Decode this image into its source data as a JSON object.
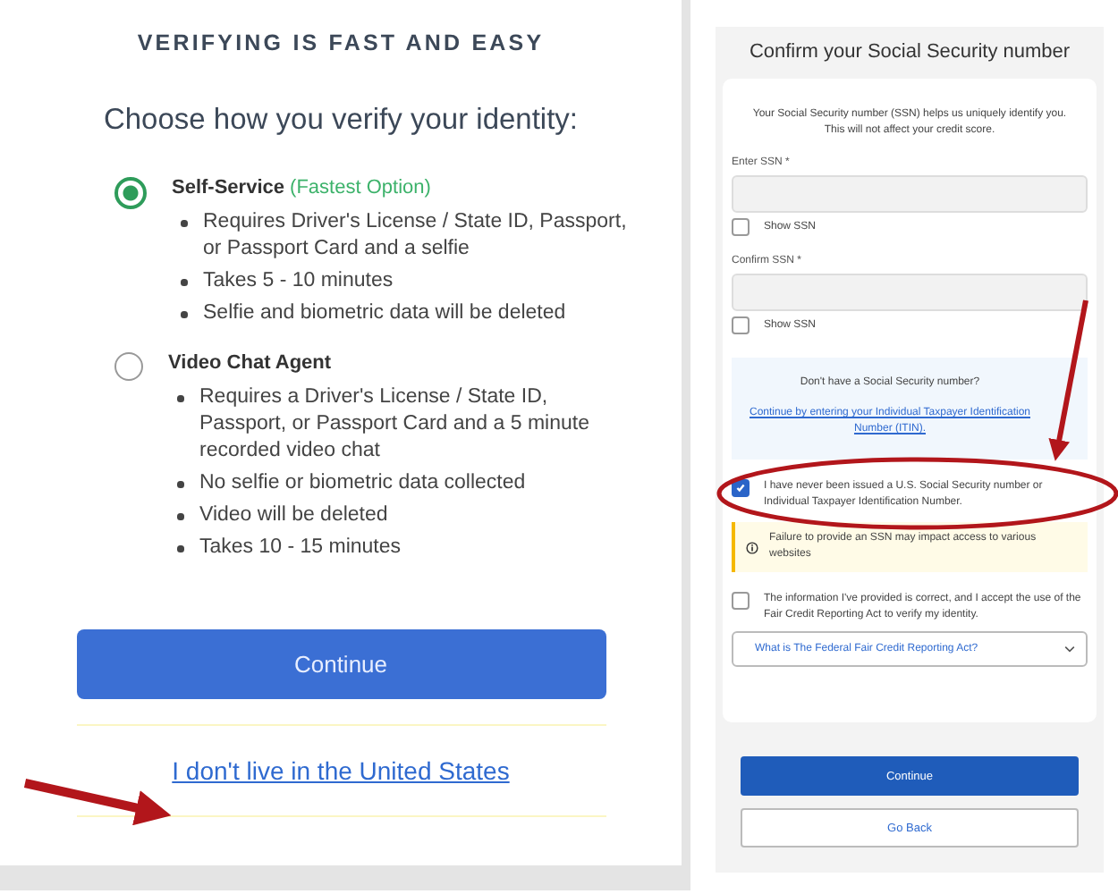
{
  "left": {
    "heading": "VERIFYING IS FAST AND EASY",
    "question": "Choose how you verify your identity:",
    "options": [
      {
        "title": "Self-Service",
        "note": "(Fastest Option)",
        "selected": true,
        "bullets": [
          "Requires Driver's License / State ID, Passport, or Passport Card and a selfie",
          "Takes 5 - 10 minutes",
          "Selfie and biometric data will be deleted"
        ]
      },
      {
        "title": "Video Chat Agent",
        "selected": false,
        "bullets": [
          "Requires a Driver's License / State ID, Passport, or Passport Card and a 5 minute recorded video chat",
          "No selfie or biometric data collected",
          "Video will be deleted",
          "Takes 10 - 15 minutes"
        ]
      }
    ],
    "continue_button": "Continue",
    "link": "I don't live in the United States"
  },
  "right": {
    "title": "Confirm your Social Security number",
    "intro": "Your Social Security number (SSN) helps us uniquely identify you. This will not affect your credit score.",
    "fields": [
      {
        "label": "Enter SSN *",
        "show_label": "Show SSN",
        "show_checked": false
      },
      {
        "label": "Confirm SSN *",
        "show_label": "Show SSN",
        "show_checked": false
      }
    ],
    "itin": {
      "question": "Don't have a Social Security number?",
      "link": "Continue by entering your Individual Taxpayer Identification Number (ITIN)."
    },
    "checks": [
      {
        "kind": "checkbox",
        "text": "I have never been issued a U.S. Social Security number or Individual Taxpayer Identification Number.",
        "checked": true
      },
      {
        "kind": "warning",
        "text": "Failure to provide an SSN may impact access to various websites"
      },
      {
        "kind": "checkbox",
        "text": "The information I've provided is correct, and I accept the use of the Fair Credit Reporting Act to verify my identity.",
        "checked": false
      },
      {
        "kind": "accordion",
        "text": "What is The Federal Fair Credit Reporting Act?",
        "expanded": false
      }
    ],
    "buttons": [
      {
        "label": "Continue",
        "kind": "primary"
      },
      {
        "label": "Go Back",
        "kind": "secondary"
      }
    ]
  }
}
